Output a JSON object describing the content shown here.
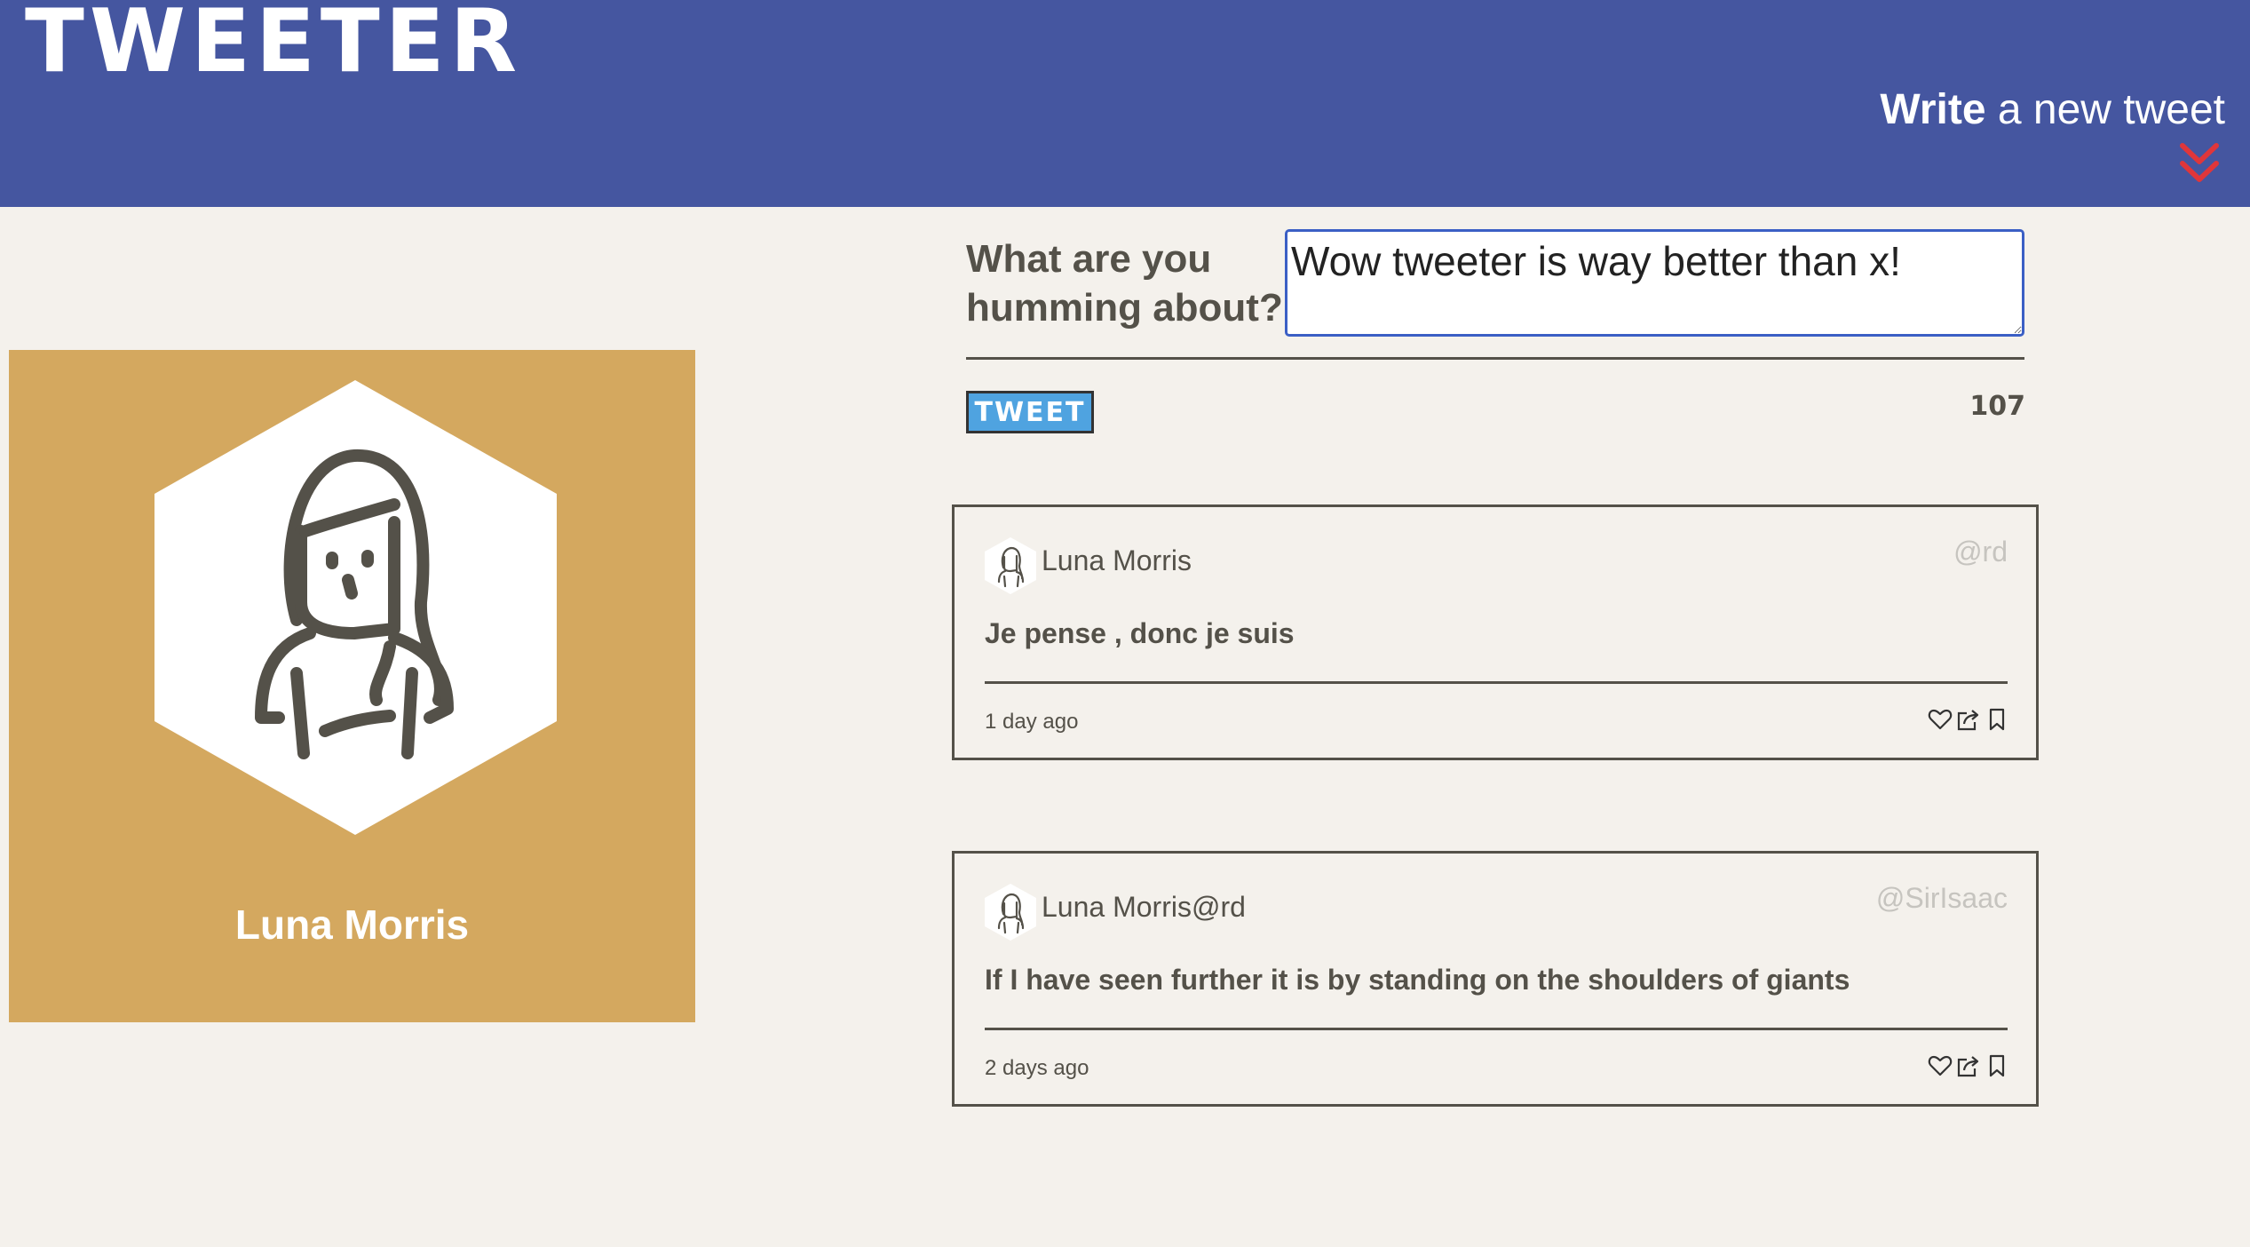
{
  "nav": {
    "logo": "TWEETER",
    "write_bold": "Write",
    "write_rest": " a new tweet"
  },
  "profile": {
    "name": "Luna Morris"
  },
  "compose": {
    "label": "What are you humming about?",
    "value": "Wow tweeter is way better than x!",
    "button_label": "TWEET",
    "counter": "107"
  },
  "tweets": [
    {
      "name": "Luna Morris",
      "handle": "@rd",
      "text": "Je pense , donc je suis",
      "time": "1 day ago"
    },
    {
      "name": "Luna Morris@rd",
      "handle": "@SirIsaac",
      "text": "If I have seen further it is by standing on the shoulders of giants",
      "time": "2 days ago"
    }
  ],
  "icons": {
    "write": "chevron-double-down-icon",
    "like": "heart-icon",
    "retweet": "share-icon",
    "bookmark": "bookmark-icon"
  },
  "colors": {
    "nav_bg": "#4556a0",
    "page_bg": "#f4f1ec",
    "profile_bg": "#d4a85f",
    "accent_red": "#e0363a",
    "button_blue": "#4fa3e0",
    "input_focus": "#3b5fc5"
  }
}
